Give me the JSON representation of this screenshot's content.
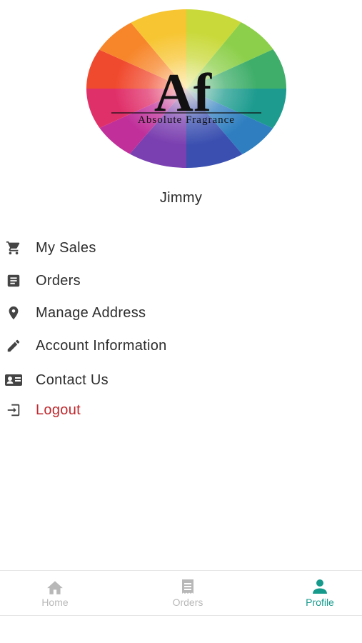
{
  "brand": {
    "logo_monogram": "Af",
    "logo_text": "Absolute Fragrance"
  },
  "user": {
    "name": "Jimmy"
  },
  "menu": {
    "items": [
      {
        "label": "My Sales",
        "icon": "cart-icon"
      },
      {
        "label": "Orders",
        "icon": "list-icon"
      },
      {
        "label": "Manage Address",
        "icon": "location-pin-icon"
      },
      {
        "label": "Account Information",
        "icon": "pencil-icon"
      },
      {
        "label": "Contact Us",
        "icon": "contact-card-icon"
      },
      {
        "label": "Logout",
        "icon": "logout-icon"
      }
    ]
  },
  "bottom_nav": {
    "items": [
      {
        "label": "Home",
        "icon": "home-icon",
        "active": false
      },
      {
        "label": "Orders",
        "icon": "receipt-icon",
        "active": false
      },
      {
        "label": "Profile",
        "icon": "person-icon",
        "active": true
      }
    ]
  },
  "colors": {
    "accent": "#159a8c",
    "logout": "#c0282d",
    "inactive_nav": "#b8b8b8",
    "text": "#2d2d2d"
  }
}
